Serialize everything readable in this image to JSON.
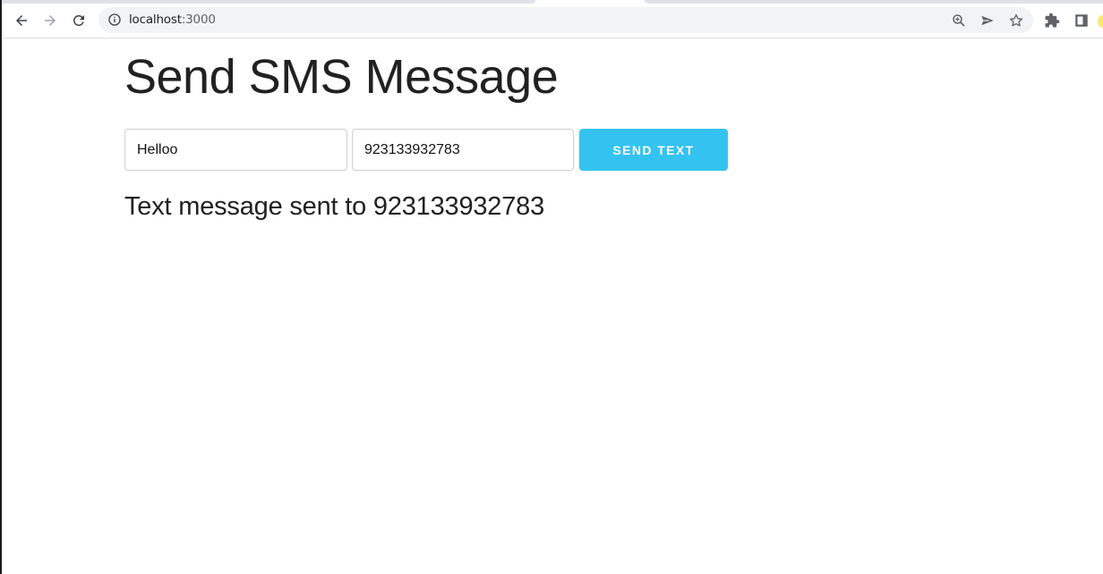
{
  "browser": {
    "url_host": "localhost",
    "url_port": ":3000",
    "nav": {
      "back_icon": "arrow-left-icon",
      "forward_icon": "arrow-right-icon",
      "reload_icon": "reload-icon"
    },
    "omnibox_icons": [
      "info-icon",
      "zoom-icon",
      "send-icon",
      "star-icon"
    ],
    "toolbar_icons": [
      "puzzle-icon",
      "sidepanel-icon",
      "profile-avatar"
    ]
  },
  "page": {
    "title": "Send SMS Message",
    "form": {
      "message_value": "Helloo",
      "phone_value": "923133932783",
      "send_label": "Send Text"
    },
    "status_message": "Text message sent to 923133932783"
  },
  "colors": {
    "accent": "#34c3f0",
    "text": "#212121"
  }
}
